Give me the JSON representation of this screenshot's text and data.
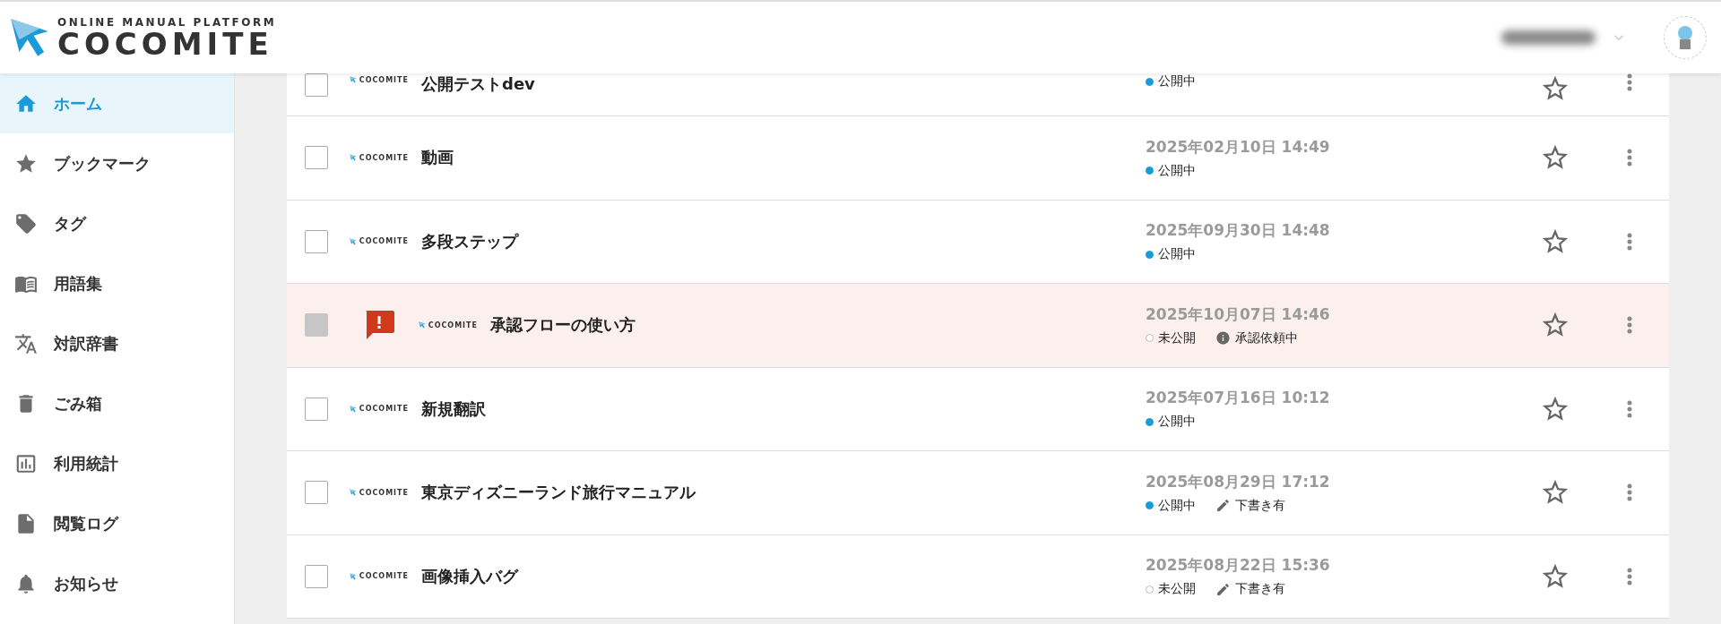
{
  "header": {
    "logo": {
      "tagline": "ONLINE MANUAL PLATFORM",
      "name": "COCOMITE"
    }
  },
  "sidebar": {
    "items": [
      {
        "label": "ホーム",
        "selected": true
      },
      {
        "label": "ブックマーク",
        "selected": false
      },
      {
        "label": "タグ",
        "selected": false
      },
      {
        "label": "用語集",
        "selected": false
      },
      {
        "label": "対訳辞書",
        "selected": false
      },
      {
        "label": "ごみ箱",
        "selected": false
      },
      {
        "label": "利用統計",
        "selected": false
      },
      {
        "label": "閲覧ログ",
        "selected": false
      },
      {
        "label": "お知らせ",
        "selected": false
      }
    ]
  },
  "manuals": [
    {
      "kind": "partial",
      "logo": "COCOMITE",
      "title": "公開テストdev",
      "status": {
        "label": "公開中",
        "published": true
      },
      "checked": false,
      "disabled": false,
      "alert": false,
      "bookmarked": false
    },
    {
      "kind": "full",
      "logo": "COCOMITE",
      "title": "動画",
      "date": "2025年02月10日 14:49",
      "status": {
        "label": "公開中",
        "published": true
      },
      "checked": false,
      "disabled": false,
      "alert": false,
      "bookmarked": false
    },
    {
      "kind": "full",
      "logo": "COCOMITE",
      "title": "多段ステップ",
      "date": "2025年09月30日 14:48",
      "status": {
        "label": "公開中",
        "published": true
      },
      "checked": false,
      "disabled": false,
      "alert": false,
      "bookmarked": false
    },
    {
      "kind": "full",
      "logo": "COCOMITE",
      "title": "承認フローの使い方",
      "date": "2025年10月07日 14:46",
      "status": {
        "label": "未公開",
        "published": false
      },
      "approval": "承認依頼中",
      "checked": false,
      "disabled": true,
      "alert": true,
      "bookmarked": false
    },
    {
      "kind": "full",
      "logo": "COCOMITE",
      "title": "新規翻訳",
      "date": "2025年07月16日 10:12",
      "status": {
        "label": "公開中",
        "published": true
      },
      "checked": false,
      "disabled": false,
      "alert": false,
      "bookmarked": false
    },
    {
      "kind": "full",
      "logo": "COCOMITE",
      "title": "東京ディズニーランド旅行マニュアル",
      "date": "2025年08月29日 17:12",
      "status": {
        "label": "公開中",
        "published": true
      },
      "draft": "下書き有",
      "checked": false,
      "disabled": false,
      "alert": false,
      "bookmarked": false
    },
    {
      "kind": "full",
      "logo": "COCOMITE",
      "title": "画像挿入バグ",
      "date": "2025年08月22日 15:36",
      "status": {
        "label": "未公開",
        "published": false
      },
      "draft": "下書き有",
      "checked": false,
      "disabled": false,
      "alert": false,
      "bookmarked": false
    }
  ]
}
